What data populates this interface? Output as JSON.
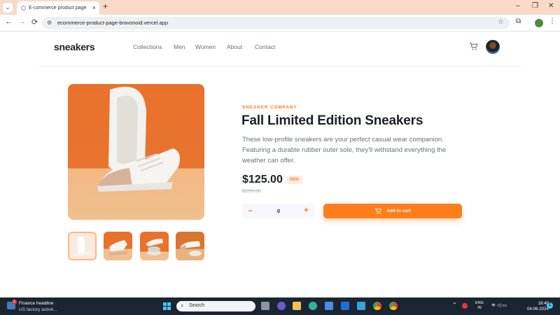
{
  "browser": {
    "tab_title": "E-commerce product page",
    "tab_close": "×",
    "new_tab": "+",
    "tablist": "⌄",
    "url": "ecommerce-product-page-bravonoid.vercel.app",
    "profile_initial": "",
    "win_min": "–",
    "win_max": "❐",
    "win_close": "✕",
    "back": "←",
    "forward": "→",
    "reload": "⟳",
    "star": "☆",
    "extensions": "⧉",
    "menu": "⋮"
  },
  "site": {
    "logo": "sneakers",
    "nav": [
      "Collections",
      "Men",
      "Women",
      "About",
      "Contact"
    ]
  },
  "product": {
    "company": "SNEAKER COMPANY",
    "title": "Fall Limited Edition Sneakers",
    "description": "These low-profile sneakers are your perfect casual wear companion. Featuring a durable rubber outer sole, they'll withstand everything the weather can offer.",
    "price": "$125.00",
    "discount": "50%",
    "old_price": "$250.00",
    "quantity": "0",
    "minus": "−",
    "plus": "+",
    "add_to_cart": "Add to cart"
  },
  "taskbar": {
    "news_title": "Finance headline",
    "news_sub": "US factory activit...",
    "badge": "1",
    "search": "Search",
    "lang_1": "ENG",
    "lang_2": "IN",
    "time": "18:40",
    "date": "04-06-2024",
    "notif": "1"
  },
  "colors": {
    "accent": "#ff7d1a",
    "accent_pale": "#ffede0",
    "heading": "#1d2025",
    "body_text": "#69707d"
  }
}
